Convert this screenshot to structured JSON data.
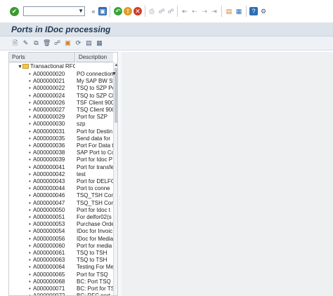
{
  "toolbar": {
    "command_value": "",
    "back_glyph": "«",
    "icons": [
      "enter-icon",
      "save-icon",
      "back-icon",
      "exit-icon",
      "cancel-icon",
      "print-icon",
      "find-icon",
      "find-next-icon",
      "first-page-icon",
      "previous-page-icon",
      "next-page-icon",
      "last-page-icon",
      "create-session-icon",
      "shortcut-icon",
      "help-icon",
      "customize-layout-icon"
    ],
    "colors": {
      "ok": "#3c9a2f",
      "save": "#2f6db3",
      "back": "#37a33a",
      "exit": "#e09a22",
      "cancel": "#d23a2a",
      "help": "#2f6db3"
    }
  },
  "title": "Ports in IDoc processing",
  "app_toolbar": {
    "icons": [
      "create-icon",
      "change-icon",
      "copy-icon",
      "delete-icon",
      "where-used-icon",
      "transport-icon",
      "refresh-icon",
      "details-icon",
      "export-icon"
    ]
  },
  "tree": {
    "col_ports": "Ports",
    "col_description": "Description",
    "root": {
      "label": "Transactional RFC",
      "expanded": true
    },
    "rows": [
      {
        "port": "A000000020",
        "desc": "PO connection"
      },
      {
        "port": "A000000021",
        "desc": "My SAP BW Sy"
      },
      {
        "port": "A000000022",
        "desc": "TSQ to SZP Po"
      },
      {
        "port": "A000000024",
        "desc": "TSQ to SZP Cl"
      },
      {
        "port": "A000000026",
        "desc": "TSF Client 900"
      },
      {
        "port": "A000000027",
        "desc": "TSQ Client 900"
      },
      {
        "port": "A000000029",
        "desc": "Port for SZP"
      },
      {
        "port": "A000000030",
        "desc": "szp"
      },
      {
        "port": "A000000031",
        "desc": "Port for Destin"
      },
      {
        "port": "A000000035",
        "desc": "Send data for"
      },
      {
        "port": "A000000036",
        "desc": "Port For Data t"
      },
      {
        "port": "A000000038",
        "desc": "SAP Port to Co"
      },
      {
        "port": "A000000039",
        "desc": "Port for Idoc P"
      },
      {
        "port": "A000000041",
        "desc": "Port for transfe"
      },
      {
        "port": "A000000042",
        "desc": "test"
      },
      {
        "port": "A000000043",
        "desc": "Port for DELFO"
      },
      {
        "port": "A000000044",
        "desc": "Port to conne"
      },
      {
        "port": "A000000046",
        "desc": "TSQ_TSH Con"
      },
      {
        "port": "A000000047",
        "desc": "TSQ_TSH Con"
      },
      {
        "port": "A000000050",
        "desc": "Port for Idoc t"
      },
      {
        "port": "A000000051",
        "desc": "For delfor02(s"
      },
      {
        "port": "A000000053",
        "desc": "Purchase Orde"
      },
      {
        "port": "A000000054",
        "desc": "IDoc for Invoic"
      },
      {
        "port": "A000000056",
        "desc": "IDoc for Media"
      },
      {
        "port": "A000000060",
        "desc": "Port for media"
      },
      {
        "port": "A000000061",
        "desc": "TSQ to TSH"
      },
      {
        "port": "A000000063",
        "desc": "TSQ to TSH"
      },
      {
        "port": "A000000064",
        "desc": "Testing For Me"
      },
      {
        "port": "A000000065",
        "desc": "Port for TSQ"
      },
      {
        "port": "A000000068",
        "desc": "BC: Port TSQ"
      },
      {
        "port": "A000000071",
        "desc": "BC: Port for TS"
      },
      {
        "port": "A000000072",
        "desc": "BC: RFC port"
      }
    ]
  }
}
